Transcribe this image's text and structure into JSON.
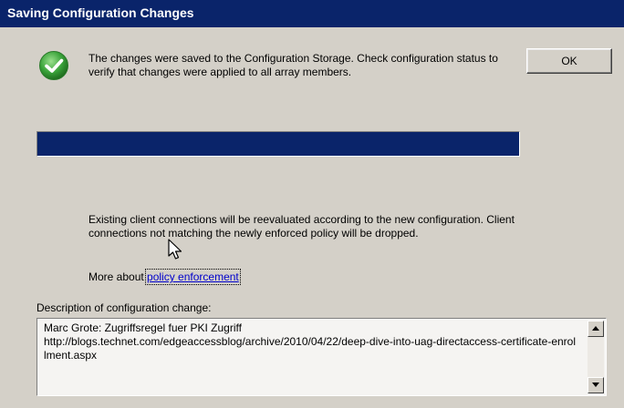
{
  "dialog": {
    "title": "Saving Configuration Changes",
    "message": "The changes were saved to the Configuration Storage. Check configuration status to verify that changes were applied to all array members.",
    "ok_label": "OK",
    "progress_fraction": 1.0,
    "info_text": "Existing client connections will be reevaluated according to the new configuration. Client connections not matching the newly enforced policy will be dropped.",
    "more_prefix": "More about ",
    "more_link": "policy enforcement",
    "description_label": "Description of configuration change:",
    "description_text": "Marc Grote: Zugriffsregel fuer PKI Zugriff\nhttp://blogs.technet.com/edgeaccessblog/archive/2010/04/22/deep-dive-into-uag-directaccess-certificate-enrollment.aspx"
  },
  "colors": {
    "titlebar": "#0a246a",
    "progress_fill": "#0a246a",
    "success_icon": "#3aa33a",
    "link": "#0000cc"
  },
  "icons": {
    "status": "check-circle-icon",
    "pointer": "mouse-cursor-icon"
  }
}
